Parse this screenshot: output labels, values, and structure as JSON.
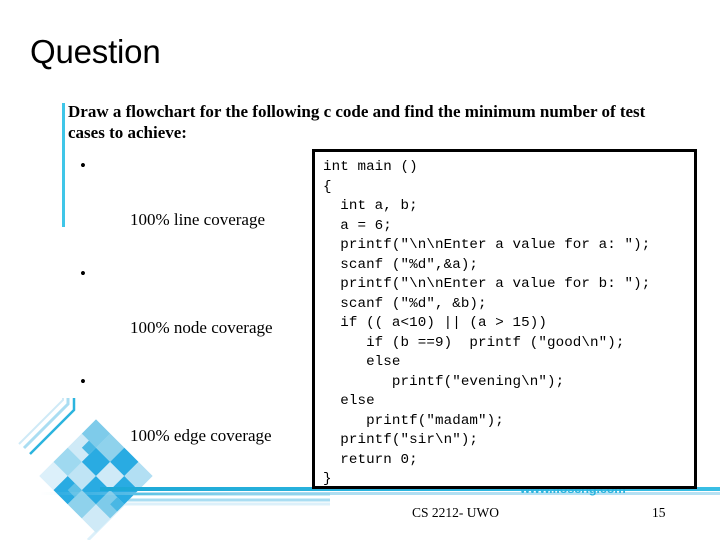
{
  "slide": {
    "title": "Question",
    "lead_text": "Draw a flowchart for the following c code and find the minimum number of test cases to achieve:",
    "bullets": [
      {
        "marker": "•",
        "label": "100% line coverage"
      },
      {
        "marker": "•",
        "label": "100% node coverage"
      },
      {
        "marker": "•",
        "label": "100% edge coverage"
      }
    ],
    "code": "int main ()\n{\n  int a, b;\n  a = 6;\n  printf(\"\\n\\nEnter a value for a: \");\n  scanf (\"%d\",&a);\n  printf(\"\\n\\nEnter a value for b: \");\n  scanf (\"%d\", &b);\n  if (( a<10) || (a > 15))\n     if (b ==9)  printf (\"good\\n\");\n     else\n        printf(\"evening\\n\");\n  else\n     printf(\"madam\");\n  printf(\"sir\\n\");\n  return 0;\n}",
    "watermark": "www.floseng.com",
    "footer": {
      "center_text": "CS 2212- UWO",
      "page_number": "15"
    },
    "colors": {
      "accent_cyan": "#3FC6E8",
      "divider_cyan": "#2BB4DE",
      "deco_bright": "#29ABE2",
      "deco_light": "#9FD9F0",
      "code_border": "#000000",
      "text": "#000000",
      "background": "#FFFFFF"
    }
  }
}
